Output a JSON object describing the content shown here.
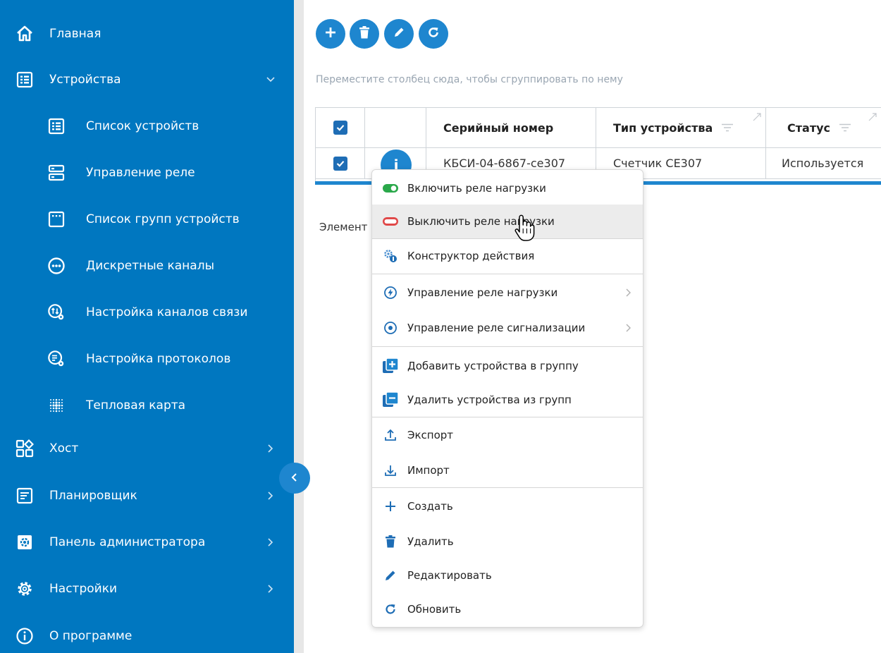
{
  "sidebar": {
    "items": [
      {
        "label": "Главная",
        "icon": "home-icon",
        "has_arrow": false,
        "arrow": "none"
      },
      {
        "label": "Устройства",
        "icon": "list-icon",
        "has_arrow": true,
        "arrow": "down"
      },
      {
        "label": "Список устройств",
        "icon": "list-icon",
        "sub": true
      },
      {
        "label": "Управление реле",
        "icon": "relay-icon",
        "sub": true
      },
      {
        "label": "Список групп устройств",
        "icon": "group-list-icon",
        "sub": true
      },
      {
        "label": "Дискретные каналы",
        "icon": "discrete-channels-icon",
        "sub": true
      },
      {
        "label": "Настройка каналов связи",
        "icon": "channel-settings-icon",
        "sub": true
      },
      {
        "label": "Настройка протоколов",
        "icon": "protocol-settings-icon",
        "sub": true
      },
      {
        "label": "Тепловая карта",
        "icon": "heatmap-icon",
        "sub": true
      },
      {
        "label": "Хост",
        "icon": "host-icon",
        "arrow": "right"
      },
      {
        "label": "Планировщик",
        "icon": "scheduler-icon",
        "arrow": "right"
      },
      {
        "label": "Панель администратора",
        "icon": "admin-panel-icon",
        "arrow": "right"
      },
      {
        "label": "Настройки",
        "icon": "settings-gear-icon",
        "arrow": "right"
      },
      {
        "label": "О программе",
        "icon": "info-icon",
        "arrow": "none"
      }
    ],
    "collapse_icon": "chevron-left-icon"
  },
  "toolbar": {
    "buttons": [
      "add-icon",
      "delete-icon",
      "edit-icon",
      "refresh-icon"
    ]
  },
  "group_hint": "Переместите столбец сюда, чтобы сгруппировать по нему",
  "table": {
    "columns": [
      "Серийный номер",
      "Тип устройства",
      "Статус"
    ],
    "rows": [
      {
        "serial": "КБСИ-04-6867-се307",
        "type": "Счетчик СЕ307",
        "status": "Используется",
        "checked": true
      }
    ],
    "header_checked": true,
    "info_button": "i"
  },
  "elements_label": "Элемент",
  "context_menu": {
    "items": [
      {
        "label": "Включить реле нагрузки",
        "icon": "toggle-on-icon",
        "color": "#2aa84a"
      },
      {
        "label": "Выключить реле нагрузки",
        "icon": "toggle-off-icon",
        "color": "#e04848",
        "hovered": true
      },
      {
        "label": "Конструктор действия",
        "icon": "action-constructor-icon"
      },
      {
        "label": "Управление реле нагрузки",
        "icon": "lightning-icon",
        "submenu": true
      },
      {
        "label": "Управление реле сигнализации",
        "icon": "radio-dot-icon",
        "submenu": true
      },
      {
        "label": "Добавить устройства в группу",
        "icon": "add-to-group-icon"
      },
      {
        "label": "Удалить устройства из групп",
        "icon": "remove-from-group-icon"
      },
      {
        "label": "Экспорт",
        "icon": "export-icon"
      },
      {
        "label": "Импорт",
        "icon": "import-icon"
      },
      {
        "label": "Создать",
        "icon": "plus-icon"
      },
      {
        "label": "Удалить",
        "icon": "trash-icon"
      },
      {
        "label": "Редактировать",
        "icon": "pencil-icon"
      },
      {
        "label": "Обновить",
        "icon": "refresh-icon"
      }
    ]
  },
  "colors": {
    "sidebar_bg": "#0077c0",
    "accent": "#1e86cf",
    "checkbox": "#1e6db5",
    "hover_bg": "#ececec"
  }
}
